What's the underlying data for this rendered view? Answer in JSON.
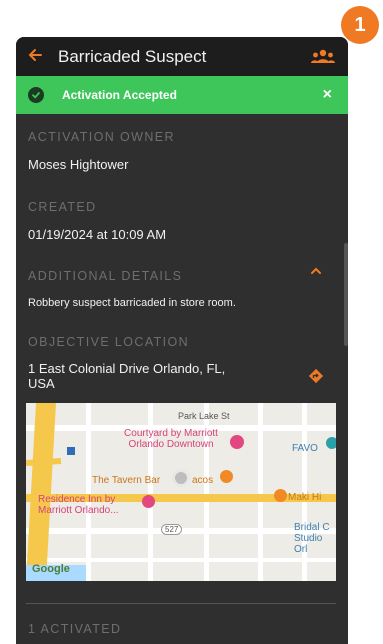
{
  "step_badge": "1",
  "appbar": {
    "title": "Barricaded Suspect",
    "back_icon": "arrow-left-icon",
    "people_icon": "group-icon"
  },
  "banner": {
    "text": "Activation Accepted",
    "close": "×"
  },
  "sections": {
    "owner_label": "ACTIVATION OWNER",
    "owner_value": "Moses Hightower",
    "created_label": "CREATED",
    "created_value": "01/19/2024 at 10:09 AM",
    "details_label": "ADDITIONAL DETAILS",
    "details_value": "Robbery suspect barricaded in store room.",
    "location_label": "OBJECTIVE LOCATION",
    "location_value_line1": "1 East Colonial Drive Orlando, FL,",
    "location_value_line2": "USA",
    "activated_label": "1 ACTIVATED"
  },
  "map": {
    "labels": {
      "park_lake": "Park Lake St",
      "courtyard1": "Courtyard by Marriott",
      "courtyard2": "Orlando Downtown",
      "favo": "FAVO",
      "tavern": "The Tavern Bar",
      "tacos": "acos",
      "maki": "Maki Hi",
      "residence1": "Residence Inn by",
      "residence2": "Marriott Orlando...",
      "route": "527",
      "bridal1": "Bridal C",
      "bridal2": "Studio Orl",
      "google": "Google"
    }
  },
  "colors": {
    "accent": "#f07a23",
    "success": "#3ec65a",
    "background": "#2f2f2f",
    "appbar": "#1d1d1d"
  }
}
